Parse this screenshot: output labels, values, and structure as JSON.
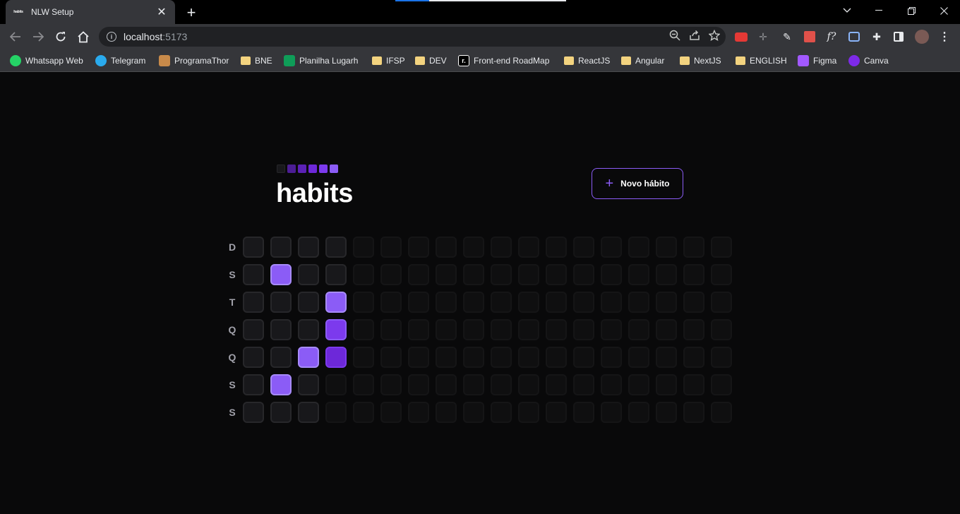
{
  "browser": {
    "tab_title": "NLW Setup",
    "tab_favicon_text": "habits",
    "url_host": "localhost",
    "url_port": ":5173"
  },
  "bookmarks": [
    {
      "label": "Whatsapp Web",
      "icon": "whatsapp-icon",
      "color": "#25d366"
    },
    {
      "label": "Telegram",
      "icon": "telegram-icon",
      "color": "#2aabee"
    },
    {
      "label": "ProgramaThor",
      "icon": "hammer-icon",
      "color": "#c88a4a"
    },
    {
      "label": "BNE",
      "icon": "folder-icon",
      "color": "#f3d37f"
    },
    {
      "label": "Planilha Lugarh",
      "icon": "sheets-icon",
      "color": "#0f9d58"
    },
    {
      "label": "IFSP",
      "icon": "folder-icon",
      "color": "#f3d37f"
    },
    {
      "label": "DEV",
      "icon": "folder-icon",
      "color": "#f3d37f"
    },
    {
      "label": "Front-end RoadMap",
      "icon": "roadmap-icon",
      "color": "#000000"
    },
    {
      "label": "ReactJS",
      "icon": "folder-icon",
      "color": "#f3d37f"
    },
    {
      "label": "Angular",
      "icon": "folder-icon",
      "color": "#f3d37f"
    },
    {
      "label": "NextJS",
      "icon": "folder-icon",
      "color": "#f3d37f"
    },
    {
      "label": "ENGLISH",
      "icon": "folder-icon",
      "color": "#f3d37f"
    },
    {
      "label": "Figma",
      "icon": "figma-icon",
      "color": "#a259ff"
    },
    {
      "label": "Canva",
      "icon": "canva-icon",
      "color": "#7d2ae8"
    }
  ],
  "app": {
    "logo": "habits",
    "logo_square_colors": [
      "#18181b",
      "#4c1d95",
      "#5b21b6",
      "#6d28d9",
      "#7c3aed",
      "#8b5cf6"
    ],
    "new_habit_label": "Novo hábito",
    "accent": "#8b5cf6",
    "weekdays": [
      "D",
      "S",
      "T",
      "Q",
      "Q",
      "S",
      "S"
    ],
    "summary_columns": 18,
    "summary_past_days": 25,
    "completed_days": [
      {
        "index": 8,
        "level": "l1"
      },
      {
        "index": 12,
        "level": "l1"
      },
      {
        "index": 18,
        "level": "l1"
      },
      {
        "index": 23,
        "level": "l1"
      },
      {
        "index": 24,
        "level": "l2"
      },
      {
        "index": 25,
        "level": "l3"
      }
    ]
  }
}
